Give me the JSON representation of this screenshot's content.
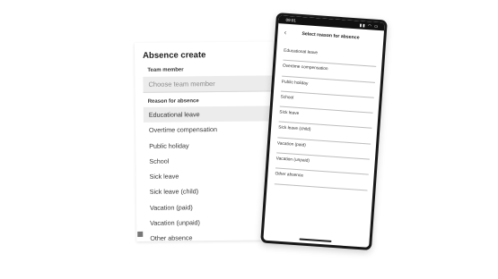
{
  "desktop": {
    "title": "Absence create",
    "team_member_label": "Team member",
    "team_member_placeholder": "Choose team member",
    "reason_label": "Reason for absence",
    "reasons": [
      "Educational leave",
      "Overtime compensation",
      "Public holiday",
      "School",
      "Sick leave",
      "Sick leave (child)",
      "Vacation (paid)",
      "Vacation (unpaid)",
      "Other absence"
    ],
    "selected_reason": "Educational leave"
  },
  "phone": {
    "status_time": "09:01",
    "status_icons": "▮▮ ◠ ▭",
    "back_icon": "‹",
    "title": "Select reason for absence",
    "reasons": [
      "Educational leave",
      "Overtime compensation",
      "Public holiday",
      "School",
      "Sick leave",
      "Sick leave (child)",
      "Vacation (paid)",
      "Vacation (unpaid)",
      "Other absence"
    ]
  }
}
